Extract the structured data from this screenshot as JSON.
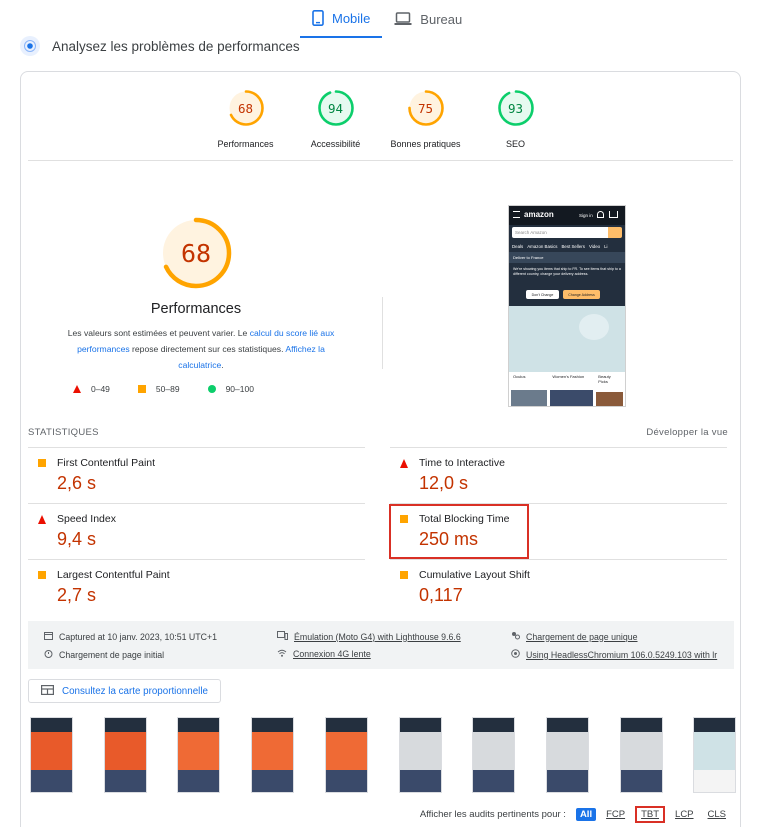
{
  "tabs": [
    {
      "label": "Mobile",
      "icon": "smartphone-icon",
      "active": true
    },
    {
      "label": "Bureau",
      "icon": "laptop-icon",
      "active": false
    }
  ],
  "header": {
    "title": "Analysez les problèmes de performances",
    "icon": "radar-icon"
  },
  "gauges": [
    {
      "score": 68,
      "label": "Performances",
      "color": "#ffa400",
      "text_color": "#c33300"
    },
    {
      "score": 94,
      "label": "Accessibilité",
      "color": "#0cce6b",
      "text_color": "#018642"
    },
    {
      "score": 75,
      "label": "Bonnes pratiques",
      "color": "#ffa400",
      "text_color": "#c33300"
    },
    {
      "score": 93,
      "label": "SEO",
      "color": "#0cce6b",
      "text_color": "#018642"
    }
  ],
  "performance": {
    "score": 68,
    "label": "Performances",
    "desc_pre": "Les valeurs sont estimées et peuvent varier. Le ",
    "desc_link1": "calcul du score lié aux performances",
    "desc_mid": " repose directement sur ces statistiques. ",
    "desc_link2": "Affichez la calculatrice",
    "desc_end": "."
  },
  "legend": [
    {
      "shape": "triangle",
      "range": "0–49",
      "color": "#eb0f00"
    },
    {
      "shape": "square",
      "range": "50–89",
      "color": "#ffa400"
    },
    {
      "shape": "circle",
      "range": "90–100",
      "color": "#0cce6b"
    }
  ],
  "screenshot": {
    "logo": "amazon",
    "signin": "Sign in",
    "search_placeholder": "Search Amazon",
    "nav": [
      "Deals",
      "Amazon Basics",
      "Best Sellers",
      "Video",
      "Li"
    ],
    "deliver": "Deliver to France",
    "notice": "We're showing you items that ship to FR. To see items that ship to a different country, change your delivery address.",
    "btn_dont": "Don't Change",
    "btn_change": "Change Address",
    "tiles": [
      "Oculus",
      "Women's Fashion",
      "Beauty Picks"
    ]
  },
  "stats": {
    "title": "STATISTIQUES",
    "expand": "Développer la vue",
    "metrics": [
      {
        "name": "First Contentful Paint",
        "value": "2,6 s",
        "rating": "average"
      },
      {
        "name": "Time to Interactive",
        "value": "12,0 s",
        "rating": "fail"
      },
      {
        "name": "Speed Index",
        "value": "9,4 s",
        "rating": "fail"
      },
      {
        "name": "Total Blocking Time",
        "value": "250 ms",
        "rating": "average"
      },
      {
        "name": "Largest Contentful Paint",
        "value": "2,7 s",
        "rating": "average"
      },
      {
        "name": "Cumulative Layout Shift",
        "value": "0,117",
        "rating": "average"
      }
    ]
  },
  "env": {
    "captured": "Captured at 10 janv. 2023, 10:51 UTC+1",
    "emulation": "Émulation (Moto G4) with Lighthouse 9.6.6",
    "single_page": "Chargement de page unique",
    "initial": "Chargement de page initial",
    "network": "Connexion 4G lente",
    "browser": "Using HeadlessChromium 106.0.5249.103 with lr"
  },
  "treemap_label": "Consultez la carte proportionnelle",
  "filter": {
    "label": "Afficher les audits pertinents pour :",
    "chips": [
      "All",
      "FCP",
      "TBT",
      "LCP",
      "CLS"
    ]
  }
}
